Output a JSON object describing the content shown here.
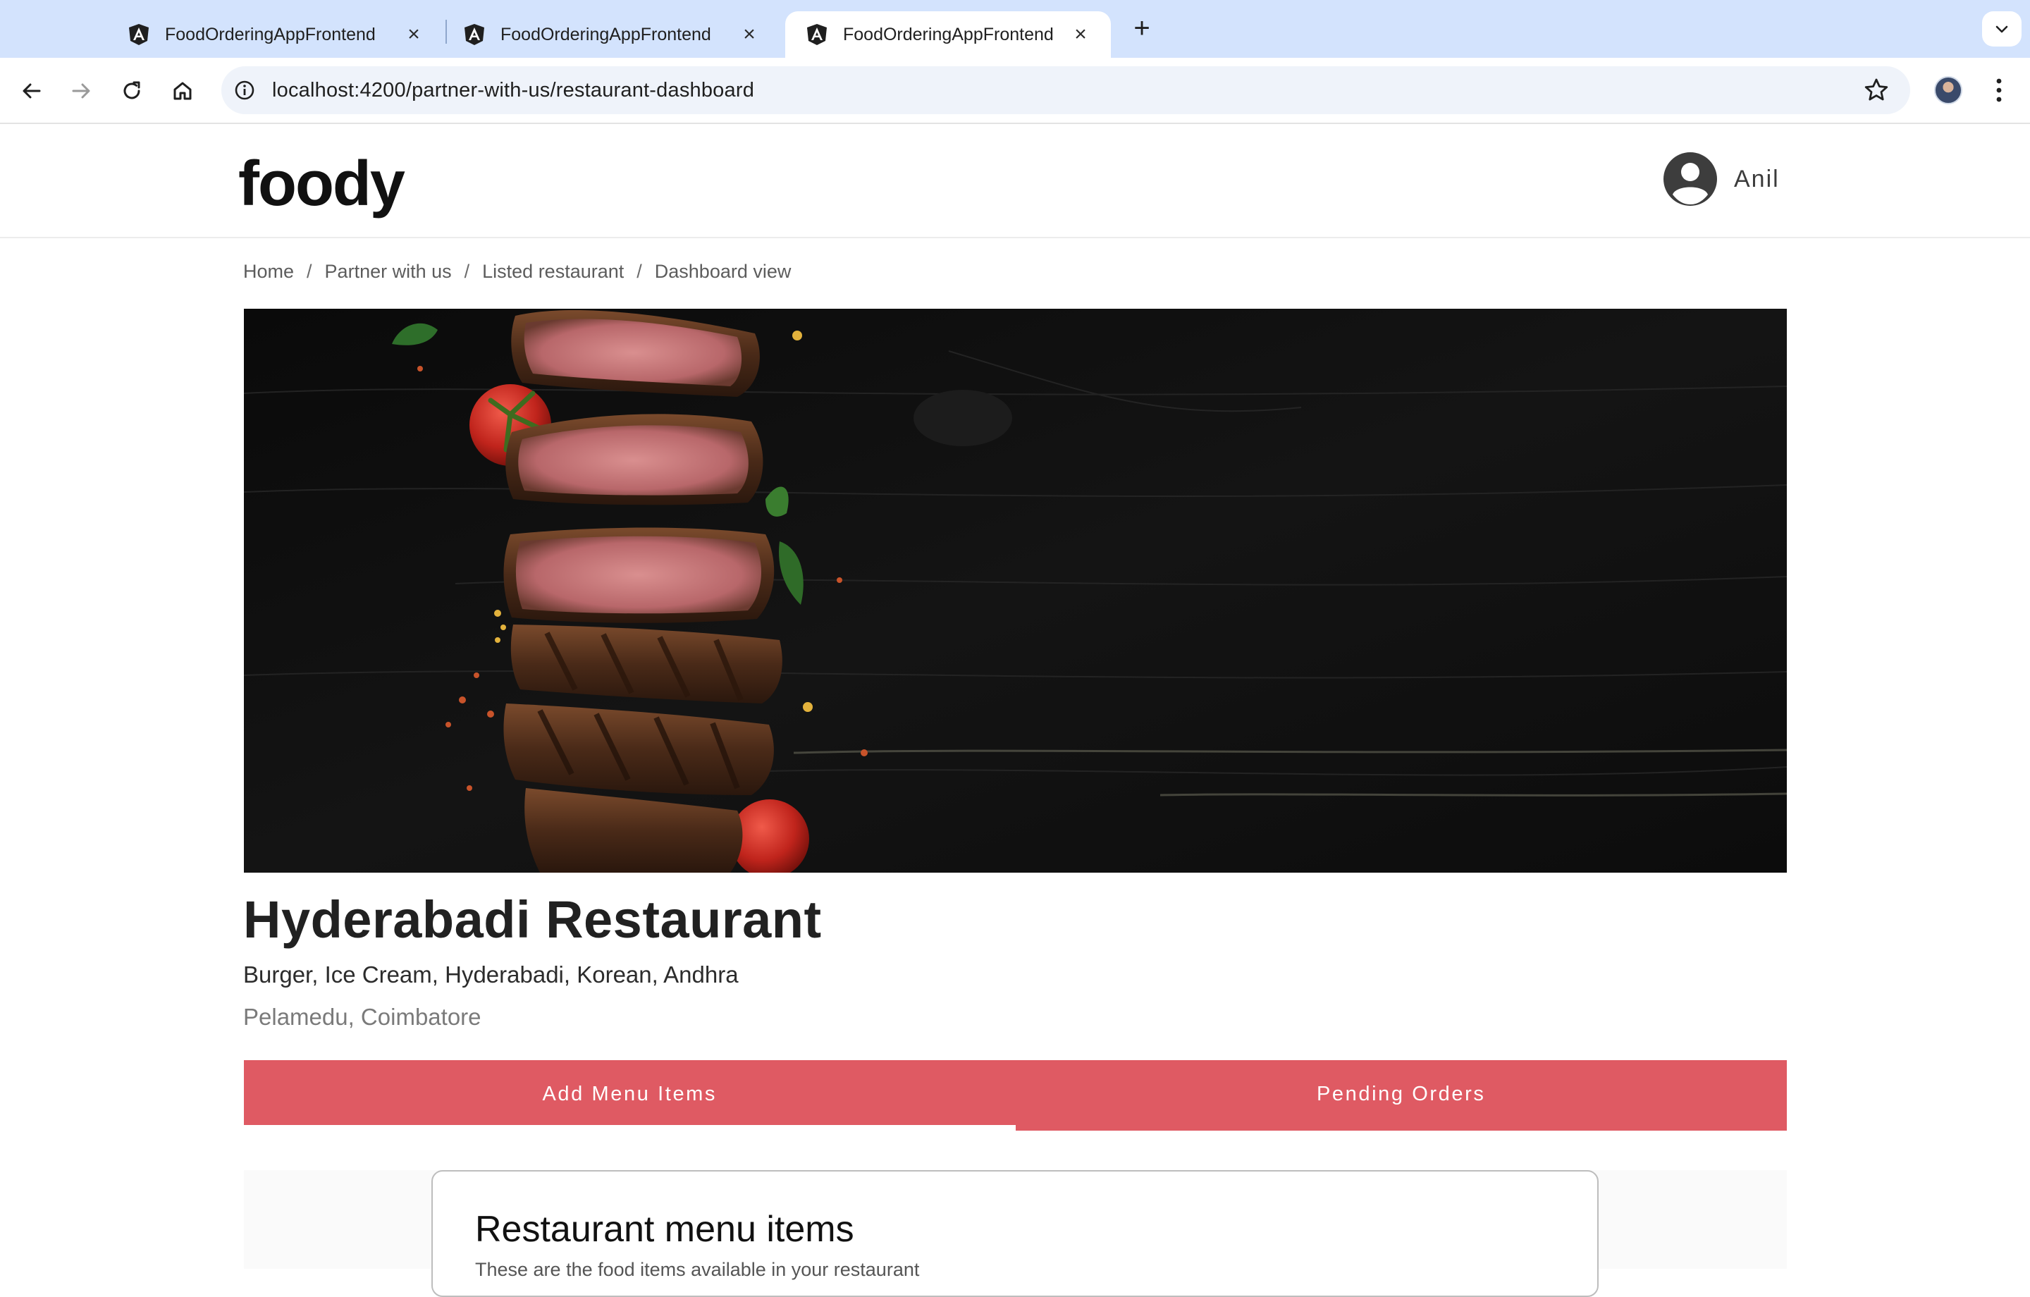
{
  "browser": {
    "tabs": [
      {
        "title": "FoodOrderingAppFrontend",
        "active": false
      },
      {
        "title": "FoodOrderingAppFrontend",
        "active": false
      },
      {
        "title": "FoodOrderingAppFrontend",
        "active": true
      }
    ],
    "url": "localhost:4200/partner-with-us/restaurant-dashboard"
  },
  "header": {
    "logo": "foody",
    "user_name": "Anil"
  },
  "breadcrumb": [
    "Home",
    "Partner with us",
    "Listed restaurant",
    "Dashboard view"
  ],
  "restaurant": {
    "name": "Hyderabadi Restaurant",
    "cuisines": "Burger, Ice Cream, Hyderabadi, Korean, Andhra",
    "location": "Pelamedu, Coimbatore"
  },
  "dashboard_tabs": [
    {
      "label": "Add Menu Items",
      "active": true
    },
    {
      "label": "Pending Orders",
      "active": false
    }
  ],
  "menu_card": {
    "title": "Restaurant menu items",
    "subtitle": "These are the food items available in your restaurant"
  },
  "colors": {
    "accent": "#df5a63",
    "tabstrip": "#d3e3fd"
  }
}
